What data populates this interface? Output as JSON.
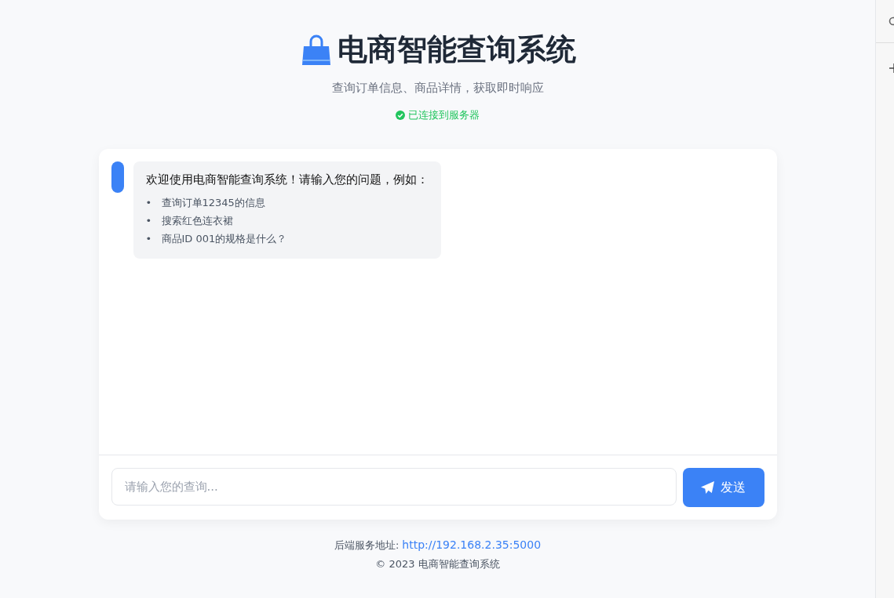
{
  "header": {
    "title": "电商智能查询系统",
    "subtitle": "查询订单信息、商品详情，获取即时响应",
    "connection": {
      "text": "已连接到服务器",
      "connected": true
    }
  },
  "chat": {
    "messages": [
      {
        "text": "欢迎使用电商智能查询系统！请输入您的问题，例如：",
        "examples": [
          {
            "bullet": "•",
            "text": "查询订单12345的信息"
          },
          {
            "bullet": "•",
            "text": "搜索红色连衣裙"
          },
          {
            "bullet": "•",
            "text": "商品ID 001的规格是什么？"
          }
        ]
      }
    ],
    "input": {
      "placeholder": "请输入您的查询..."
    },
    "send_button": "发送"
  },
  "footer": {
    "server_label": "后端服务地址:",
    "server_url": "http://192.168.2.35:5000",
    "copyright": "© 2023 电商智能查询系统"
  }
}
